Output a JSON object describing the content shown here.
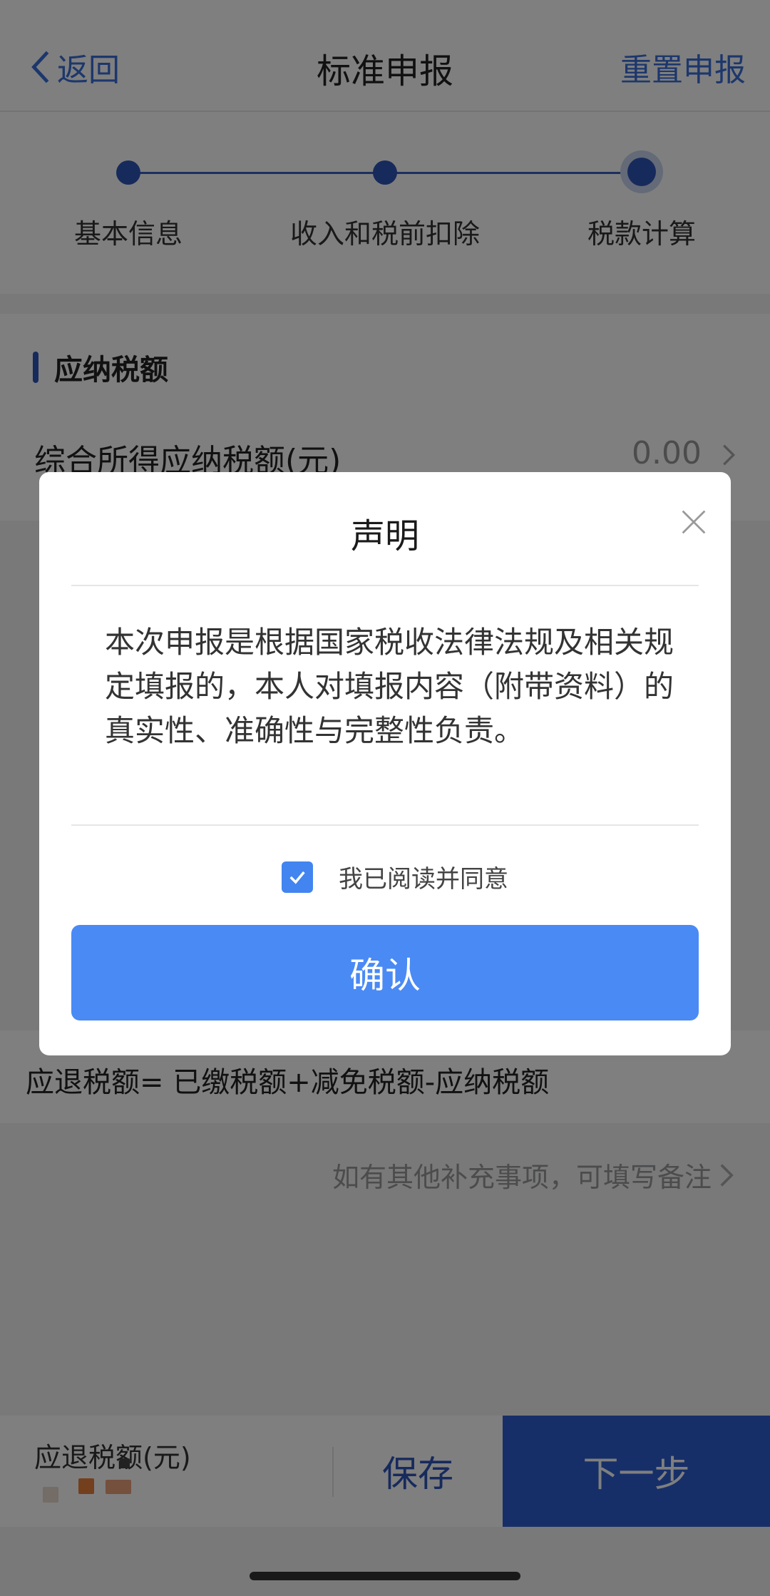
{
  "header": {
    "back_label": "返回",
    "title": "标准申报",
    "reset_label": "重置申报"
  },
  "steps": [
    {
      "label": "基本信息",
      "state": "done"
    },
    {
      "label": "收入和税前扣除",
      "state": "done"
    },
    {
      "label": "税款计算",
      "state": "current"
    }
  ],
  "section": {
    "title": "应纳税额",
    "row_label": "综合所得应纳税额(元)",
    "row_value": "0.00"
  },
  "formula": "应退税额= 已缴税额+减免税额-应纳税额",
  "remark_link": "如有其他补充事项，可填写备注",
  "bottom_bar": {
    "refund_label": "应退税额(元)",
    "save_label": "保存",
    "next_label": "下一步"
  },
  "modal": {
    "title": "声明",
    "body": "本次申报是根据国家税收法律法规及相关规定填报的，本人对填报内容（附带资料）的真实性、准确性与完整性负责。",
    "agree_label": "我已阅读并同意",
    "agree_checked": true,
    "confirm_label": "确认"
  },
  "colors": {
    "primary": "#2f55b8",
    "button_blue": "#4a8af4",
    "link_blue": "#3a6fd8"
  }
}
